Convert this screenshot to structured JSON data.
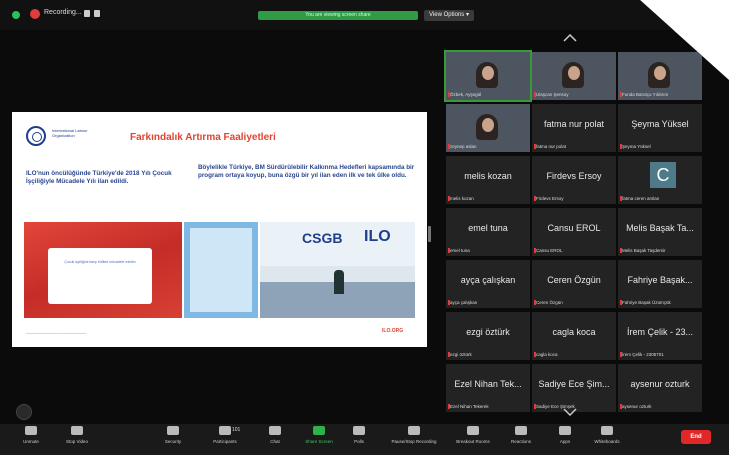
{
  "topbar": {
    "recording_label": "Recording...",
    "share_text": "You are viewing screen share",
    "view_options_label": "View Options ▾"
  },
  "slide": {
    "title": "Farkındalık Artırma Faaliyetleri",
    "left_text": "ILO'nun öncülüğünde Türkiye'de 2018 Yılı Çocuk İşçiliğiyle Mücadele Yılı ilan edildi.",
    "right_text": "Böylelikle Türkiye, BM Sürdürülebilir Kalkınma Hedefleri kapsamında bir program ortaya koyup, buna özgü bir yıl ilan eden ilk ve tek ülke oldu.",
    "image_caption": "Çocuk işçiliğine karşı birlikte mücadele edelim",
    "csgg": "CSGB",
    "ilo_mark": "ILO",
    "footer_right": "ILO.ORG"
  },
  "participants": [
    {
      "name": "",
      "label": "Özbek, Ayşegül",
      "type": "video",
      "active": true
    },
    {
      "name": "",
      "label": "Ulaşcan Şensoy",
      "type": "video",
      "active": false
    },
    {
      "name": "",
      "label": "Funda Barutçu Yıldırım",
      "type": "video",
      "active": false
    },
    {
      "name": "",
      "label": "zeynep aslan",
      "type": "video",
      "active": false
    },
    {
      "name": "fatma nur polat",
      "label": "fatma nur polat",
      "type": "name"
    },
    {
      "name": "Şeyma Yüksel",
      "label": "Şeyma Yüksel",
      "type": "name"
    },
    {
      "name": "melis kozan",
      "label": "melis kozan",
      "type": "name"
    },
    {
      "name": "Firdevs Ersoy",
      "label": "Firdevs Ersoy",
      "type": "name"
    },
    {
      "name": "C",
      "label": "fatma ceren arslan",
      "type": "avatar"
    },
    {
      "name": "emel tuna",
      "label": "emel tuna",
      "type": "name"
    },
    {
      "name": "Cansu EROL",
      "label": "Cansu EROL",
      "type": "name"
    },
    {
      "name": "Melis Başak Ta...",
      "label": "Melis Başak Taşdemir",
      "type": "name"
    },
    {
      "name": "ayça çalışkan",
      "label": "ayça çalışkan",
      "type": "name"
    },
    {
      "name": "Ceren Özgün",
      "label": "Ceren Özgün",
      "type": "name"
    },
    {
      "name": "Fahriye Başak...",
      "label": "Fahriye Başak Üzümçük",
      "type": "name"
    },
    {
      "name": "ezgi öztürk",
      "label": "ezgi öztürk",
      "type": "name"
    },
    {
      "name": "cagla koca",
      "label": "cagla koca",
      "type": "name"
    },
    {
      "name": "İrem Çelik - 23...",
      "label": "İrem Çelik - 2305701",
      "type": "name"
    },
    {
      "name": "Ezel Nihan Tek...",
      "label": "Ezel Nihan Tekerek",
      "type": "name"
    },
    {
      "name": "Sadiye Ece Şim...",
      "label": "Sadiye Ece Şimşek",
      "type": "name"
    },
    {
      "name": "aysenur ozturk",
      "label": "aysenur ozturk",
      "type": "name"
    }
  ],
  "toolbar": {
    "unmute": "Unmute",
    "stop_video": "Stop Video",
    "security": "Security",
    "participants": "Participants",
    "participants_count": "101",
    "chat": "Chat",
    "share_screen": "Share Screen",
    "polls": "Polls",
    "record": "Pause/Stop Recording",
    "breakout": "Breakout Rooms",
    "reactions": "Reactions",
    "apps": "Apps",
    "whiteboards": "Whiteboards",
    "end": "End"
  },
  "colors": {
    "accent_green": "#2fb24a",
    "end_red": "#e02828",
    "slide_title": "#e04430",
    "slide_text": "#2a4690"
  }
}
